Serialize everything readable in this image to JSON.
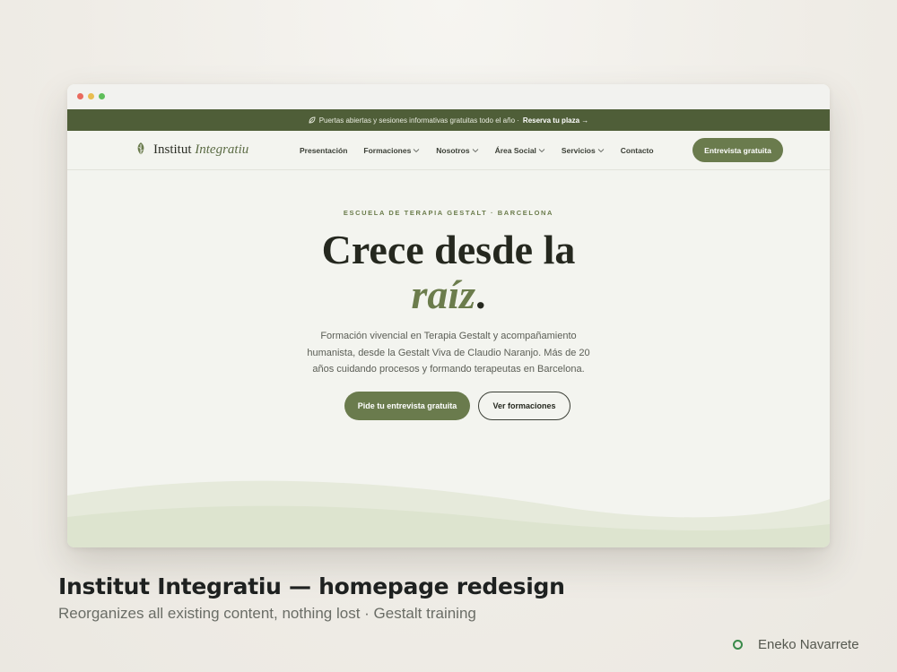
{
  "announcement": {
    "icon": "leaf-icon",
    "text": "Puertas abiertas y sesiones informativas gratuitas todo el año ·",
    "cta": "Reserva tu plaza →"
  },
  "brand": {
    "name": "Institut",
    "name_italic": "Integratiu"
  },
  "nav": {
    "items": [
      {
        "label": "Presentación",
        "dropdown": false
      },
      {
        "label": "Formaciones",
        "dropdown": true
      },
      {
        "label": "Nosotros",
        "dropdown": true
      },
      {
        "label": "Área Social",
        "dropdown": true
      },
      {
        "label": "Servicios",
        "dropdown": true
      },
      {
        "label": "Contacto",
        "dropdown": false
      }
    ],
    "cta": "Entrevista gratuita"
  },
  "hero": {
    "eyebrow": "ESCUELA DE TERAPIA GESTALT · BARCELONA",
    "headline_line1": "Crece desde la",
    "headline_italic": "raíz",
    "headline_end": ".",
    "lead": "Formación vivencial en Terapia Gestalt y acompañamiento humanista, desde la Gestalt Viva de Claudio Naranjo. Más de 20 años cuidando procesos y formando terapeutas en Barcelona.",
    "primary_button": "Pide tu entrevista gratuita",
    "secondary_button": "Ver formaciones"
  },
  "caption": {
    "title": "Institut Integratiu — homepage redesign",
    "subtitle": "Reorganizes all existing content, nothing lost · Gestalt training"
  },
  "author": {
    "name": "Eneko Navarrete"
  },
  "colors": {
    "accent": "#6a7b4d",
    "announce_bar": "#4f5e38",
    "page_bg": "#f3f4ef",
    "wave_light": "#e6eadb",
    "wave_dark": "#dde4cf"
  }
}
